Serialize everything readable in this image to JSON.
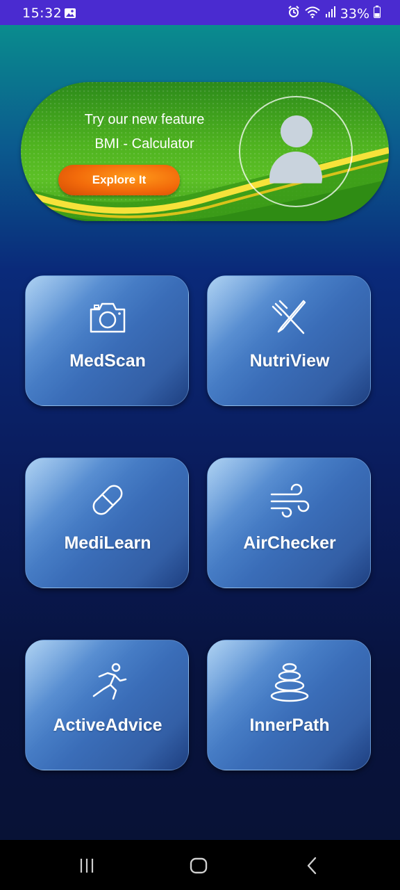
{
  "status_bar": {
    "time": "15:32",
    "battery": "33%",
    "icons": [
      "gallery-icon",
      "alarm-icon",
      "wifi-icon",
      "signal-icon",
      "battery-icon"
    ]
  },
  "banner": {
    "line1": "Try our new feature",
    "line2": "BMI - Calculator",
    "button_label": "Explore It",
    "avatar_icon": "person-avatar-icon"
  },
  "tiles": [
    {
      "label": "MedScan",
      "icon": "camera-icon"
    },
    {
      "label": "NutriView",
      "icon": "fork-knife-icon"
    },
    {
      "label": "MediLearn",
      "icon": "pill-icon"
    },
    {
      "label": "AirChecker",
      "icon": "wind-icon"
    },
    {
      "label": "ActiveAdvice",
      "icon": "running-person-icon"
    },
    {
      "label": "InnerPath",
      "icon": "stacked-stones-icon"
    }
  ],
  "nav_bar": {
    "buttons": [
      "recent-apps-icon",
      "home-icon",
      "back-icon"
    ]
  },
  "colors": {
    "status_bar": "#4a2bd0",
    "banner_green": "#4fb320",
    "button_orange": "#f26a0a",
    "tile_blue": "#3a6db8",
    "background_dark": "#081236"
  }
}
